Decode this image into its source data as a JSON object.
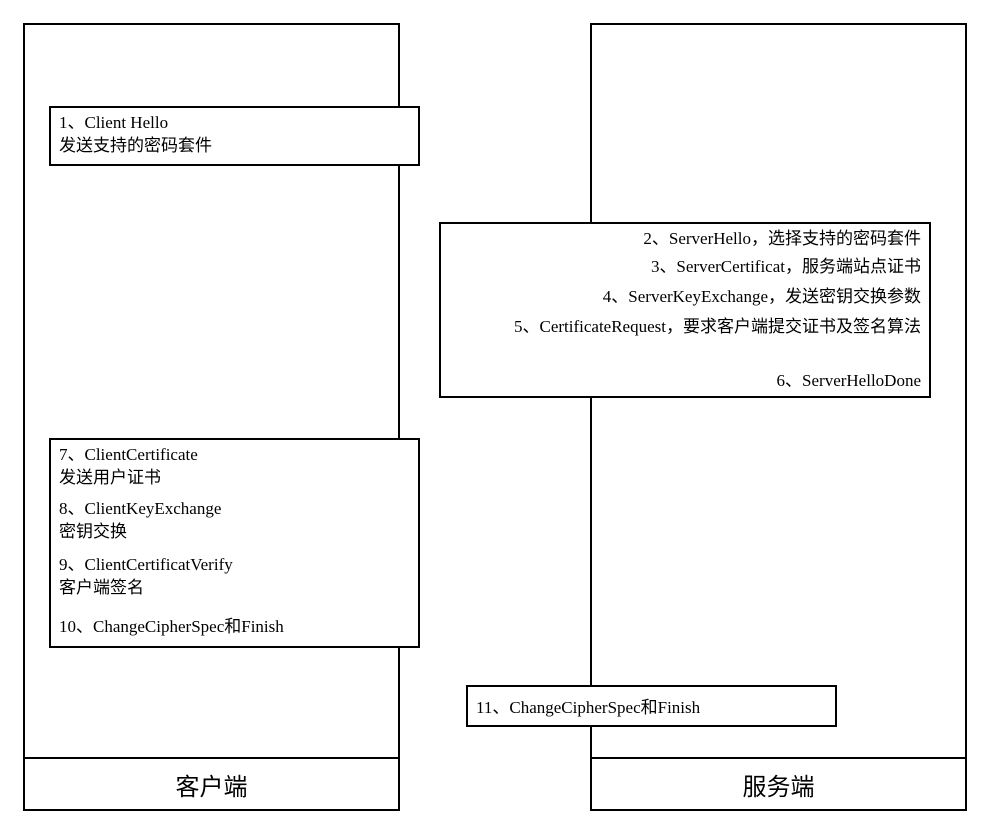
{
  "lanes": {
    "client_label": "客户端",
    "server_label": "服务端"
  },
  "messages": {
    "m1": "1、Client Hello\n发送支持的密码套件",
    "m2": "2、ServerHello，选择支持的密码套件",
    "m3": "3、ServerCertificat，服务端站点证书",
    "m4": "4、ServerKeyExchange，发送密钥交换参数",
    "m5": "5、CertificateRequest，要求客户端提交证书及签名算法",
    "m6": "6、ServerHelloDone",
    "m7": "7、ClientCertificate\n发送用户证书",
    "m8": "8、ClientKeyExchange\n密钥交换",
    "m9": "9、ClientCertificatVerify\n客户端签名",
    "m10": "10、ChangeCipherSpec和Finish",
    "m11": "11、ChangeCipherSpec和Finish"
  }
}
